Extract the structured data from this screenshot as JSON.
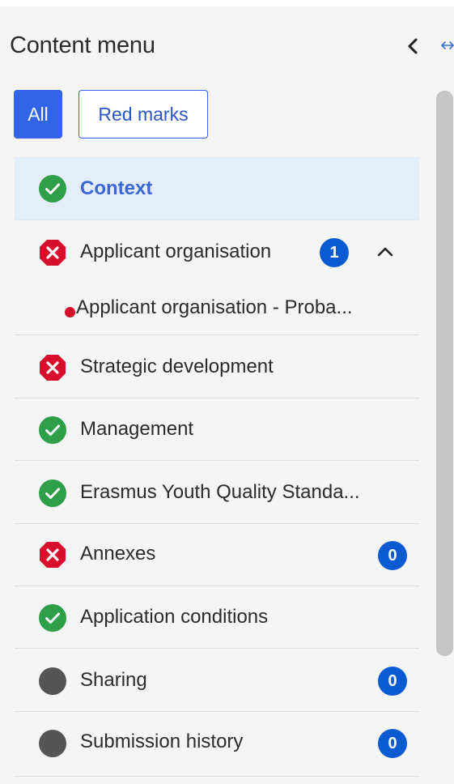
{
  "header": {
    "title": "Content menu"
  },
  "filters": {
    "all_label": "All",
    "red_marks_label": "Red marks"
  },
  "items": [
    {
      "label": "Context",
      "status": "ok",
      "active": true
    },
    {
      "label": "Applicant organisation",
      "status": "error",
      "badge": "1",
      "expanded": true,
      "subitems": [
        {
          "label": "Applicant organisation - Proba..."
        }
      ]
    },
    {
      "label": "Strategic development",
      "status": "error"
    },
    {
      "label": "Management",
      "status": "ok"
    },
    {
      "label": "Erasmus Youth Quality Standa...",
      "status": "ok"
    },
    {
      "label": "Annexes",
      "status": "error",
      "badge": "0"
    },
    {
      "label": "Application conditions",
      "status": "ok"
    },
    {
      "label": "Sharing",
      "status": "neutral",
      "badge": "0"
    },
    {
      "label": "Submission history",
      "status": "neutral",
      "badge": "0"
    }
  ],
  "colors": {
    "ok": "#2e9e48",
    "error": "#d6102c",
    "neutral": "#555555",
    "badge": "#0a5bd1",
    "accent": "#3164e6"
  },
  "icons": {
    "ok": "check-circle-icon",
    "error": "error-octagon-icon",
    "neutral": "grey-circle-icon"
  }
}
